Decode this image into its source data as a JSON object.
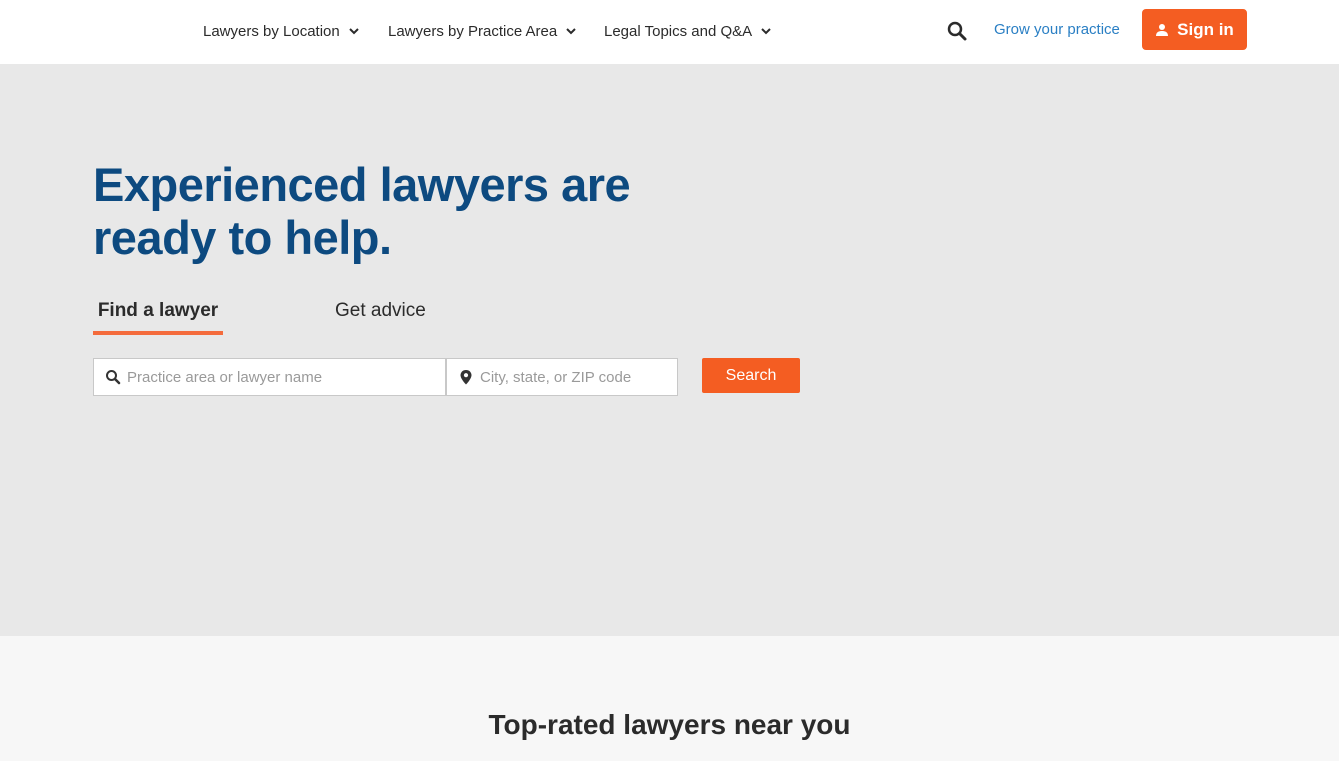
{
  "header": {
    "nav": [
      {
        "label": "Lawyers by Location",
        "icon": "chevron-down-icon"
      },
      {
        "label": "Lawyers by Practice Area",
        "icon": "chevron-down-icon"
      },
      {
        "label": "Legal Topics and Q&A",
        "icon": "chevron-down-icon"
      }
    ],
    "search_icon": "search-icon",
    "grow_link": "Grow your practice",
    "signin": {
      "label": "Sign in",
      "icon": "user-icon"
    }
  },
  "hero": {
    "title": "Experienced lawyers are ready to help.",
    "tabs": [
      {
        "label": "Find a lawyer",
        "active": true
      },
      {
        "label": "Get advice",
        "active": false
      }
    ],
    "search": {
      "practice_placeholder": "Practice area or lawyer name",
      "location_placeholder": "City, state, or ZIP code",
      "submit_label": "Search"
    }
  },
  "section": {
    "title": "Top-rated lawyers near you"
  },
  "colors": {
    "accent": "#f45d22",
    "heading": "#0d4a80",
    "link": "#2a7fc4",
    "hero_bg": "#e8e8e8"
  }
}
